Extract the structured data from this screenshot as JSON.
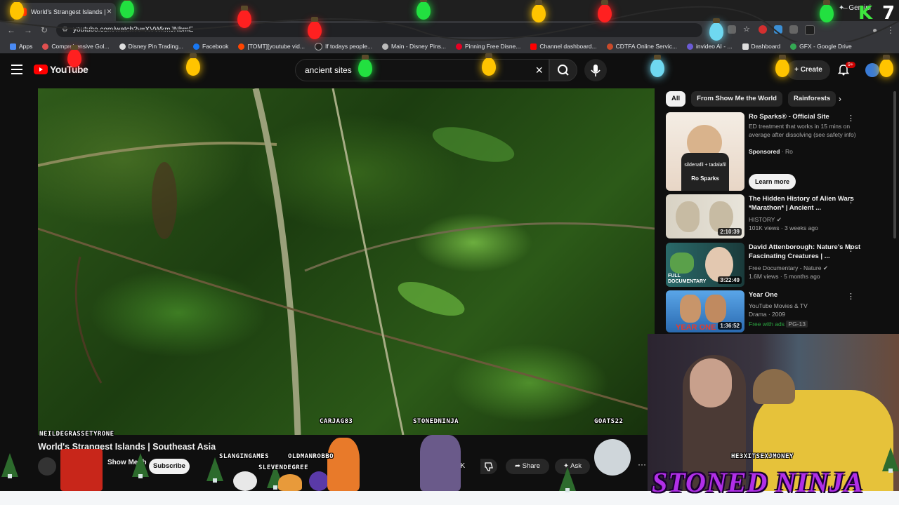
{
  "browser": {
    "tab_title": "World's Strangest Islands |",
    "tab_close": "×",
    "right_label": "Gemini",
    "url": "youtube.com/watch?v=XVWkmJNbmE",
    "bookmarks": [
      {
        "label": "Apps"
      },
      {
        "label": "Comprehensive Gol..."
      },
      {
        "label": "Disney Pin Trading..."
      },
      {
        "label": "Facebook"
      },
      {
        "label": "[TOMT][youtube vid..."
      },
      {
        "label": "If todays people..."
      },
      {
        "label": "Main - Disney Pins..."
      },
      {
        "label": "Pinning Free Disne..."
      },
      {
        "label": "Channel dashboard..."
      },
      {
        "label": "CDTFA Online Servic..."
      },
      {
        "label": "invideo AI - ..."
      },
      {
        "label": "Dashboard"
      },
      {
        "label": "GFX - Google Drive"
      }
    ]
  },
  "youtube": {
    "logo_text": "YouTube",
    "search_query": "ancient sites",
    "create_label": "Create",
    "notif_badge": "9+",
    "video_title": "World's Strangest Islands | Southeast Asia",
    "channel_name": "Show Me the World",
    "subscribe_label": "Subscribe",
    "like_count": "6K",
    "share_label": "Share",
    "ask_label": "Ask",
    "more_label": "···"
  },
  "sidebar": {
    "chips": [
      "All",
      "From Show Me the World",
      "Rainforests"
    ],
    "recommendations": [
      {
        "title": "Ro Sparks® - Official Site",
        "desc": "ED treatment that works in 15 mins on average after dissolving (see safety info)",
        "sponsored": "Sponsored",
        "advertiser": "· Ro",
        "cta": "Learn more",
        "thumb_text": "sildenafil + tadalafil",
        "thumb_brand": "Ro Sparks"
      },
      {
        "title": "The Hidden History of Alien Wars *Marathon* | Ancient ...",
        "channel": "HISTORY",
        "meta": "101K views · 3 weeks ago",
        "duration": "2:10:39"
      },
      {
        "title": "David Attenborough: Nature's Most Fascinating Creatures | ...",
        "channel": "Free Documentary - Nature",
        "meta": "1.6M views · 5 months ago",
        "duration": "3:22:49",
        "thumb_label": "FULL DOCUMENTARY"
      },
      {
        "title": "Year One",
        "channel": "YouTube Movies & TV",
        "meta": "Drama · 2009",
        "free": "Free with ads",
        "rating": "PG-13",
        "duration": "1:36:52",
        "thumb_label": "YEAR ONE"
      }
    ]
  },
  "overlay": {
    "brand": "STONED NINJA",
    "corner_logo": "K",
    "corner_num": "7",
    "usernames": [
      "NEILDEGRASSETYRONE",
      "CARJAG83",
      "STONEDNINJA",
      "GOATS22",
      "SLANGINGAMES",
      "OLDMANROBBO",
      "SLEVENDEGREE",
      "HE3XITSEXJMONEY"
    ]
  },
  "colors": {
    "bg": "#0f0f0f",
    "accent_red": "#ff0000",
    "brand_purple": "#b12fe8"
  }
}
